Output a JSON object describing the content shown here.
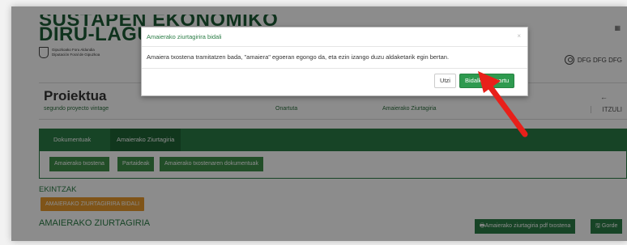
{
  "header": {
    "title_line1": "SUSTAPEN EKONOMIKO",
    "title_line2": "DIRU-LAGUN",
    "logo_line1": "Gipuzkoako Foru Aldundia",
    "logo_line2": "Diputación Foral de Gipuzkoa",
    "top_right_icon": "grid-icon",
    "user_label": "DFG DFG DFG"
  },
  "project": {
    "heading": "Proiektua",
    "name": "segundo proyecto vintage",
    "status": "Onartuta",
    "certificate": "Amaierako Ziurtagiria",
    "back_arrow": "←",
    "back_label": "ITZULI"
  },
  "tabs": [
    {
      "label": "Dokumentuak"
    },
    {
      "label": "Amaierako Ziurtagiria"
    }
  ],
  "subtabs": [
    {
      "label": "Amaierako txostena"
    },
    {
      "label": "Partaideak"
    },
    {
      "label": "Amaierako txostenaren dokumentuak"
    }
  ],
  "actions": {
    "heading": "EKINTZAK",
    "send_button": "AMAIERAKO ZIURTAGIRIRA BIDALI"
  },
  "certificate_section": {
    "heading": "AMAIERAKO ZIURTAGIRIA",
    "pdf_button": "Amaierako ziurtagiria pdf txostena",
    "save_button": "Gorde"
  },
  "modal": {
    "title": "Amaierako ziurtagirira bidali",
    "close": "×",
    "body": "Amaiera txostena tramitatzen bada, \"amaiera\" egoeran egongo da, eta ezin izango duzu aldaketarik egin bertan.",
    "cancel_label": "Utzi",
    "confirm_label": "Bidalketa onartu"
  },
  "colors": {
    "brand_green": "#2a7c45",
    "confirm_green": "#2e9a4f",
    "action_orange": "#e79a2d",
    "annotation_arrow": "#e8201a"
  }
}
